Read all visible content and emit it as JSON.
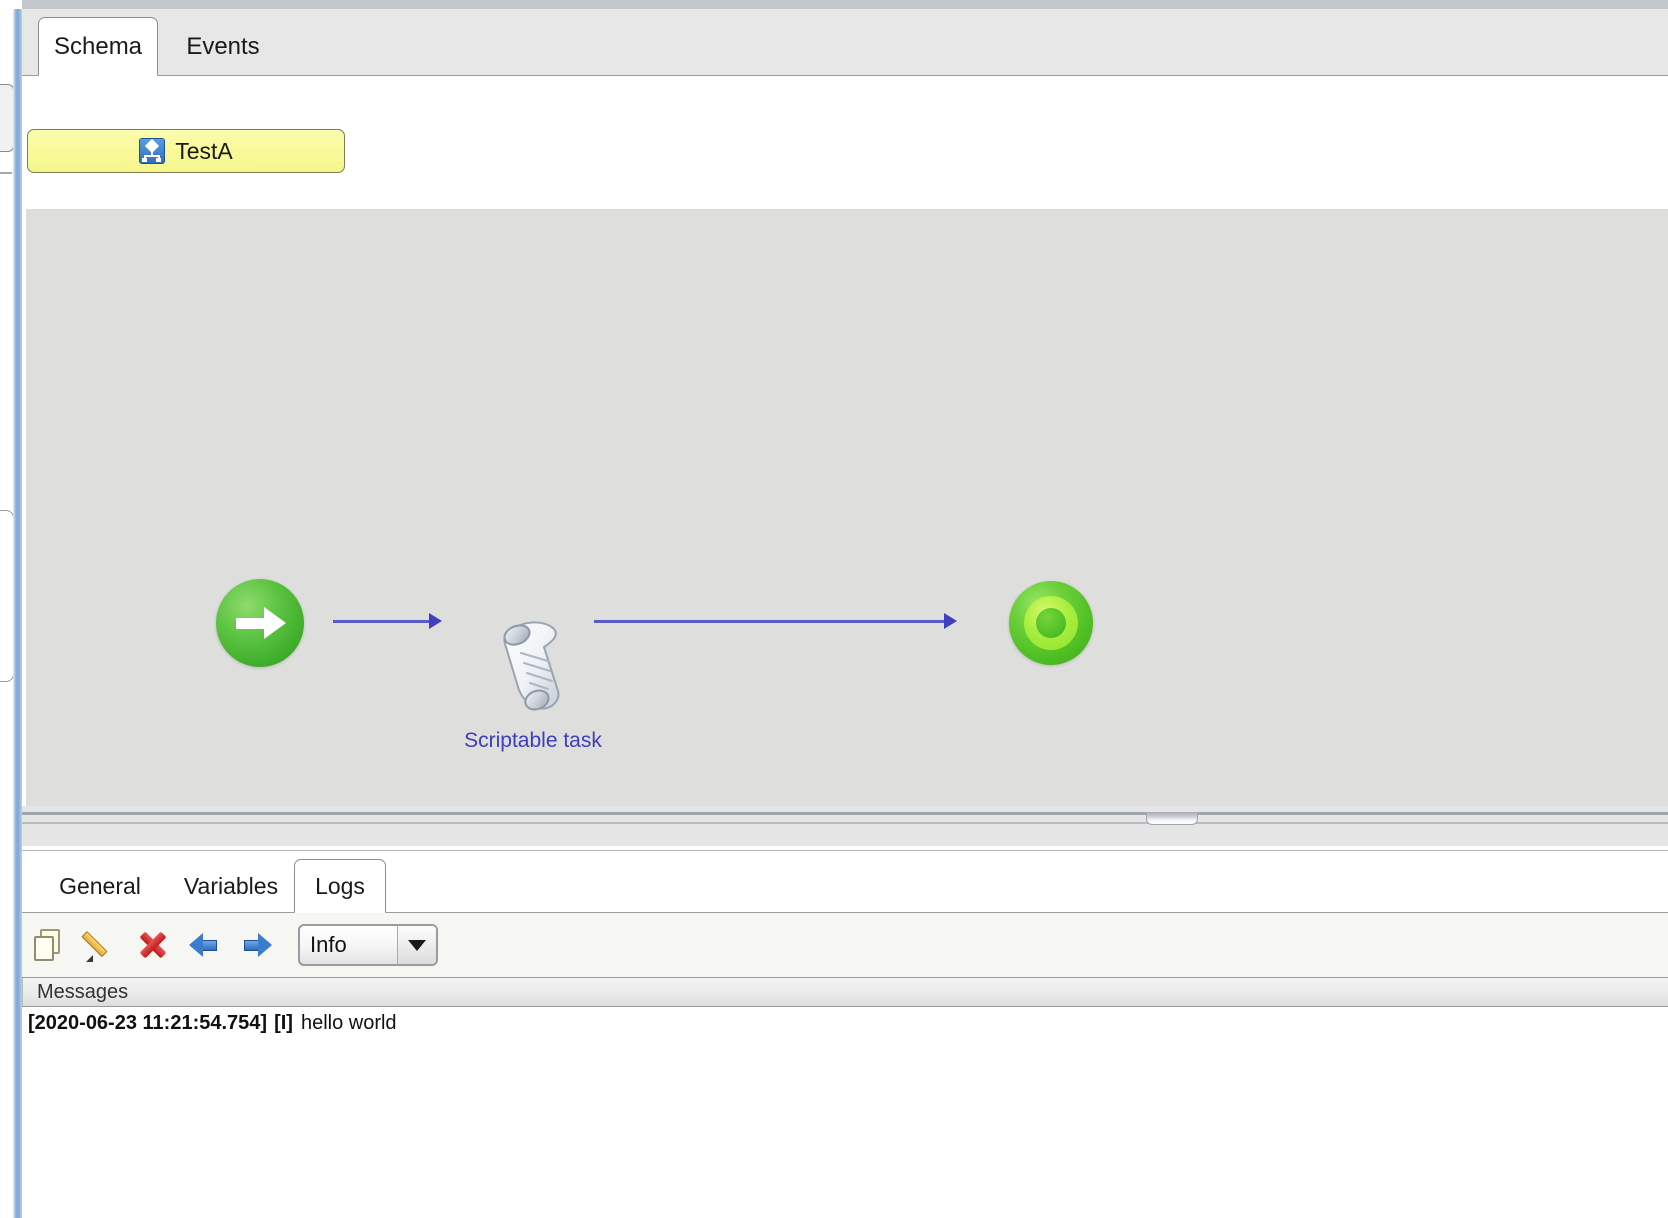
{
  "window": {
    "top_tabs": [
      {
        "label": "Schema",
        "active": true
      },
      {
        "label": "Events",
        "active": false
      }
    ],
    "process_button": {
      "label": "TestA",
      "icon": "schema-icon"
    }
  },
  "diagram": {
    "nodes": [
      {
        "id": "start",
        "type": "start-event",
        "icon": "green-arrow-circle-icon",
        "label": ""
      },
      {
        "id": "task",
        "type": "scriptable-task",
        "icon": "script-scroll-icon",
        "label": "Scriptable task"
      },
      {
        "id": "end",
        "type": "end-event",
        "icon": "green-target-circle-icon",
        "label": ""
      }
    ],
    "connectors": [
      {
        "from": "start",
        "to": "task"
      },
      {
        "from": "task",
        "to": "end"
      }
    ],
    "canvas_color": "#dededd"
  },
  "bottom": {
    "tabs": [
      {
        "label": "General",
        "active": false
      },
      {
        "label": "Variables",
        "active": false
      },
      {
        "label": "Logs",
        "active": true
      }
    ],
    "toolbar": {
      "copy_label": "copy-icon",
      "edit_label": "pencil-icon",
      "delete_label": "delete-x-icon",
      "prev_label": "arrow-left-icon",
      "next_label": "arrow-right-icon",
      "level_value": "Info"
    },
    "log_table": {
      "columns": [
        "Messages"
      ],
      "rows": [
        {
          "timestamp": "[2020-06-23 11:21:54.754]",
          "level": "[I]",
          "message": "hello world"
        }
      ]
    }
  },
  "colors": {
    "accent_blue": "#3d3db8",
    "node_green": "#4fc023",
    "highlight_yellow": "#f7f79a",
    "splitter_blue": "#7ba7d8"
  }
}
